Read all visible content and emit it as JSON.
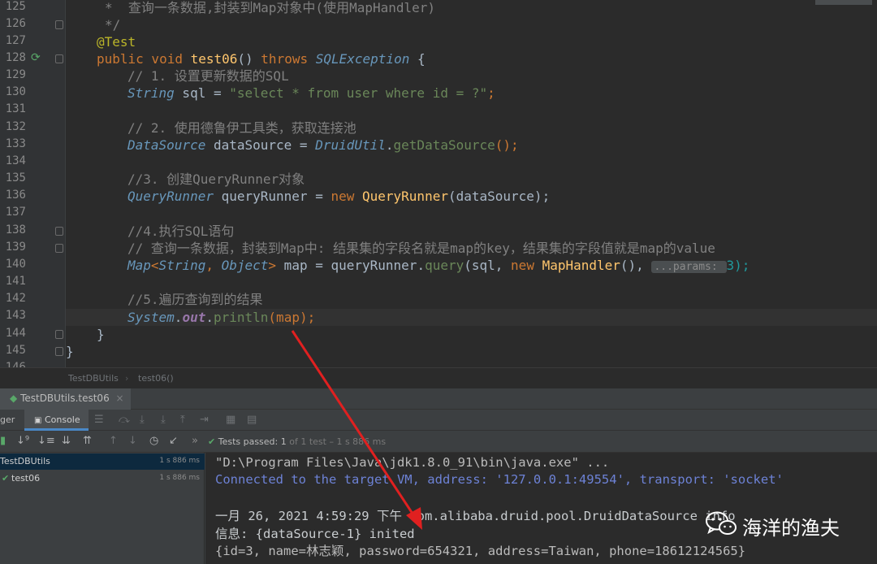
{
  "editor": {
    "lines": [
      {
        "n": "125"
      },
      {
        "n": "126"
      },
      {
        "n": "127"
      },
      {
        "n": "128"
      },
      {
        "n": "129"
      },
      {
        "n": "130"
      },
      {
        "n": "131"
      },
      {
        "n": "132"
      },
      {
        "n": "133"
      },
      {
        "n": "134"
      },
      {
        "n": "135"
      },
      {
        "n": "136"
      },
      {
        "n": "137"
      },
      {
        "n": "138"
      },
      {
        "n": "139"
      },
      {
        "n": "140"
      },
      {
        "n": "141"
      },
      {
        "n": "142"
      },
      {
        "n": "143"
      },
      {
        "n": "144"
      },
      {
        "n": "145"
      },
      {
        "n": "146"
      }
    ],
    "code": {
      "l125": "*  查询一条数据,封装到Map对象中(使用MapHandler)",
      "l126": "*/",
      "l127": "@Test",
      "l128_kw1": "public void ",
      "l128_fn": "test06",
      "l128_p": "() ",
      "l128_kw2": "throws ",
      "l128_ty": "SQLException",
      "l128_end": " {",
      "l129": "// 1. 设置更新数据的SQL",
      "l130_ty": "String",
      "l130_a": " sql = ",
      "l130_str": "\"select * from user where id = ?\"",
      "l130_end": ";",
      "l132": "// 2. 使用德鲁伊工具类，获取连接池",
      "l133_ty": "DataSource",
      "l133_a": " dataSource = ",
      "l133_ty2": "DruidUtil",
      "l133_dot": ".",
      "l133_m": "getDataSource",
      "l133_end": "();",
      "l135": "//3. 创建QueryRunner对象",
      "l136_ty": "QueryRunner",
      "l136_a": " queryRunner = ",
      "l136_kw": "new ",
      "l136_cls": "QueryRunner",
      "l136_end": "(dataSource);",
      "l138": "//4.执行SQL语句",
      "l139": "// 查询一条数据，封装到Map中: 结果集的字段名就是map的key，结果集的字段值就是map的value",
      "l140_ty": "Map",
      "l140_lt": "<",
      "l140_t1": "String",
      "l140_c": ", ",
      "l140_t2": "Object",
      "l140_gt": ">",
      "l140_a": " map = queryRunner.",
      "l140_m": "query",
      "l140_b": "(sql, ",
      "l140_kw": "new ",
      "l140_cls": "MapHandler",
      "l140_c2": "(), ",
      "l140_hint": "...params: ",
      "l140_end": "3);",
      "l142": "//5.遍历查询到的结果",
      "l143_ty": "System",
      "l143_dot": ".",
      "l143_out": "out",
      "l143_dot2": ".",
      "l143_m": "println",
      "l143_end": "(map);",
      "l144": "}",
      "l145": "}"
    },
    "breadcrumb": [
      "TestDBUtils",
      "test06()"
    ]
  },
  "run": {
    "tab_label": "TestDBUtils.test06",
    "tab_close": "×",
    "subtabs": {
      "debugger": "ger",
      "console": "Console"
    },
    "tests_passed": {
      "label": "Tests passed:",
      "count": "1",
      "rest": "of 1 test – 1 s 886 ms"
    },
    "tree": [
      {
        "name": "TestDBUtils",
        "time": "1 s 886 ms"
      },
      {
        "name": "test06",
        "time": "1 s 886 ms"
      }
    ],
    "console": [
      "\"D:\\Program Files\\Java\\jdk1.8.0_91\\bin\\java.exe\" ...",
      "Connected to the target VM, address: '127.0.0.1:49554', transport: 'socket'",
      "一月 26, 2021 4:59:29 下午 com.alibaba.druid.pool.DruidDataSource info",
      "信息: {dataSource-1} inited",
      "{id=3, name=林志颖, password=654321, address=Taiwan, phone=18612124565}"
    ]
  },
  "watermark": {
    "text": "海洋的渔夫",
    "icon": "wechat-icon"
  },
  "colors": {
    "arrow": "#e02020",
    "pass": "#59a869",
    "selected": "#0d293e",
    "accent": "#4a88c7"
  }
}
